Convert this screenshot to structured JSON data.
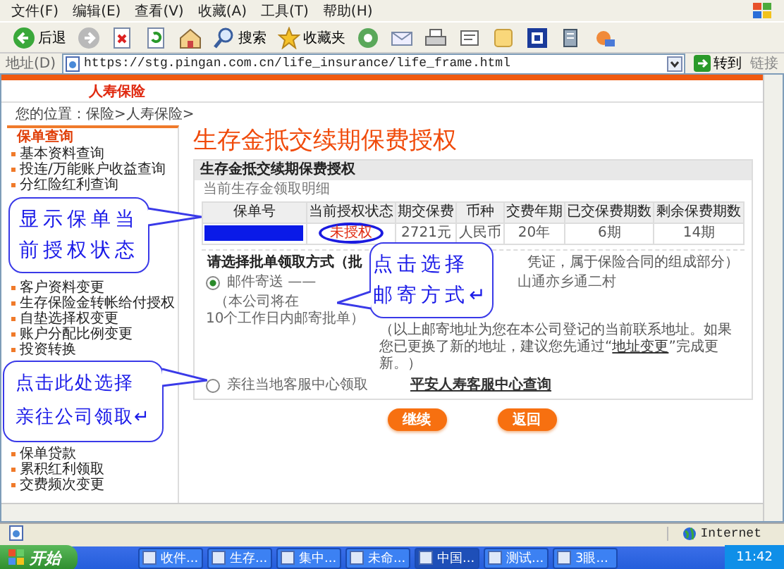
{
  "menu": [
    "文件(F)",
    "编辑(E)",
    "查看(V)",
    "收藏(A)",
    "工具(T)",
    "帮助(H)"
  ],
  "toolbar": [
    {
      "kind": "back",
      "label": "后退"
    },
    {
      "kind": "forward"
    },
    {
      "kind": "stop"
    },
    {
      "kind": "refresh"
    },
    {
      "kind": "home"
    },
    {
      "kind": "search",
      "label": "搜索"
    },
    {
      "kind": "favorites",
      "label": "收藏夹"
    },
    {
      "kind": "media"
    },
    {
      "kind": "mail"
    },
    {
      "kind": "print"
    },
    {
      "kind": "edit"
    },
    {
      "kind": "note"
    },
    {
      "kind": "messenger"
    },
    {
      "kind": "research"
    },
    {
      "kind": "tools"
    }
  ],
  "address": {
    "label": "地址(D)",
    "value": "https://stg.pingan.com.cn/life_insurance/life_frame.html",
    "go": "转到",
    "links": "链接"
  },
  "site": {
    "tab": "人寿保险",
    "breadcrumb": "您的位置：保险>人寿保险>"
  },
  "sidebar": {
    "heading": "保单查询",
    "groups": [
      [
        "基本资料查询",
        "投连/万能账户收益查询",
        "分红险红利查询"
      ],
      [
        "客户资料变更",
        "生存保险金转帐给付授权",
        "自垫选择权变更",
        "账户分配比例变更",
        "投资转换"
      ],
      [
        "保单贷款",
        "累积红利领取",
        "交费频次变更"
      ]
    ]
  },
  "main": {
    "title": "生存金抵交续期保费授权",
    "panel_title": "生存金抵交续期保费授权",
    "subtitle": "当前生存金领取明细",
    "table": {
      "columns": [
        "保单号",
        "当前授权状态",
        "期交保费",
        "币种",
        "交费年期",
        "已交保费期数",
        "剩余保费期数"
      ],
      "row": [
        {
          "kind": "redacted"
        },
        {
          "kind": "status",
          "text": "未授权",
          "circled": true
        },
        {
          "kind": "text",
          "text": "2721元"
        },
        {
          "kind": "text",
          "text": "人民币"
        },
        {
          "kind": "text",
          "text": "20年"
        },
        {
          "kind": "text",
          "text": "6期"
        },
        {
          "kind": "text",
          "text": "14期"
        }
      ]
    },
    "choice_label": "请选择批单领取方式（批",
    "choice_note": "凭证，属于保险合同的组成部分）",
    "options": [
      {
        "label": "邮件寄送 ——",
        "selected": true,
        "address": "山通亦乡通二村",
        "note_lines": [
          "（本公司将在",
          "10个工作日内邮寄批单）"
        ]
      },
      {
        "label": "亲往当地客服中心领取",
        "selected": false,
        "link": "平安人寿客服中心查询"
      }
    ],
    "address_note": {
      "before": "（以上邮寄地址为您在本公司登记的当前联系地址。如果您已更换了新的地址，建议您先通过“",
      "link": "地址变更",
      "after": "”完成更新。）"
    },
    "buttons": [
      "继续",
      "返回"
    ]
  },
  "callouts": [
    {
      "lines": [
        "显示保单当",
        "前授权状态"
      ]
    },
    {
      "lines": [
        "点击选择",
        "邮寄方式↵"
      ]
    },
    {
      "lines": [
        "点击此处选择",
        "亲往公司领取↵"
      ]
    }
  ],
  "status_bar": {
    "zone": "Internet"
  },
  "taskbar": {
    "start": "开始",
    "windows": [
      {
        "label": "收件...",
        "selected": false
      },
      {
        "label": "生存...",
        "selected": false
      },
      {
        "label": "集中...",
        "selected": false
      },
      {
        "label": "未命...",
        "selected": false
      },
      {
        "label": "中国...",
        "selected": true
      },
      {
        "label": "测试...",
        "selected": false
      },
      {
        "label": "3眼...",
        "selected": false
      }
    ],
    "clock": "11:42"
  }
}
